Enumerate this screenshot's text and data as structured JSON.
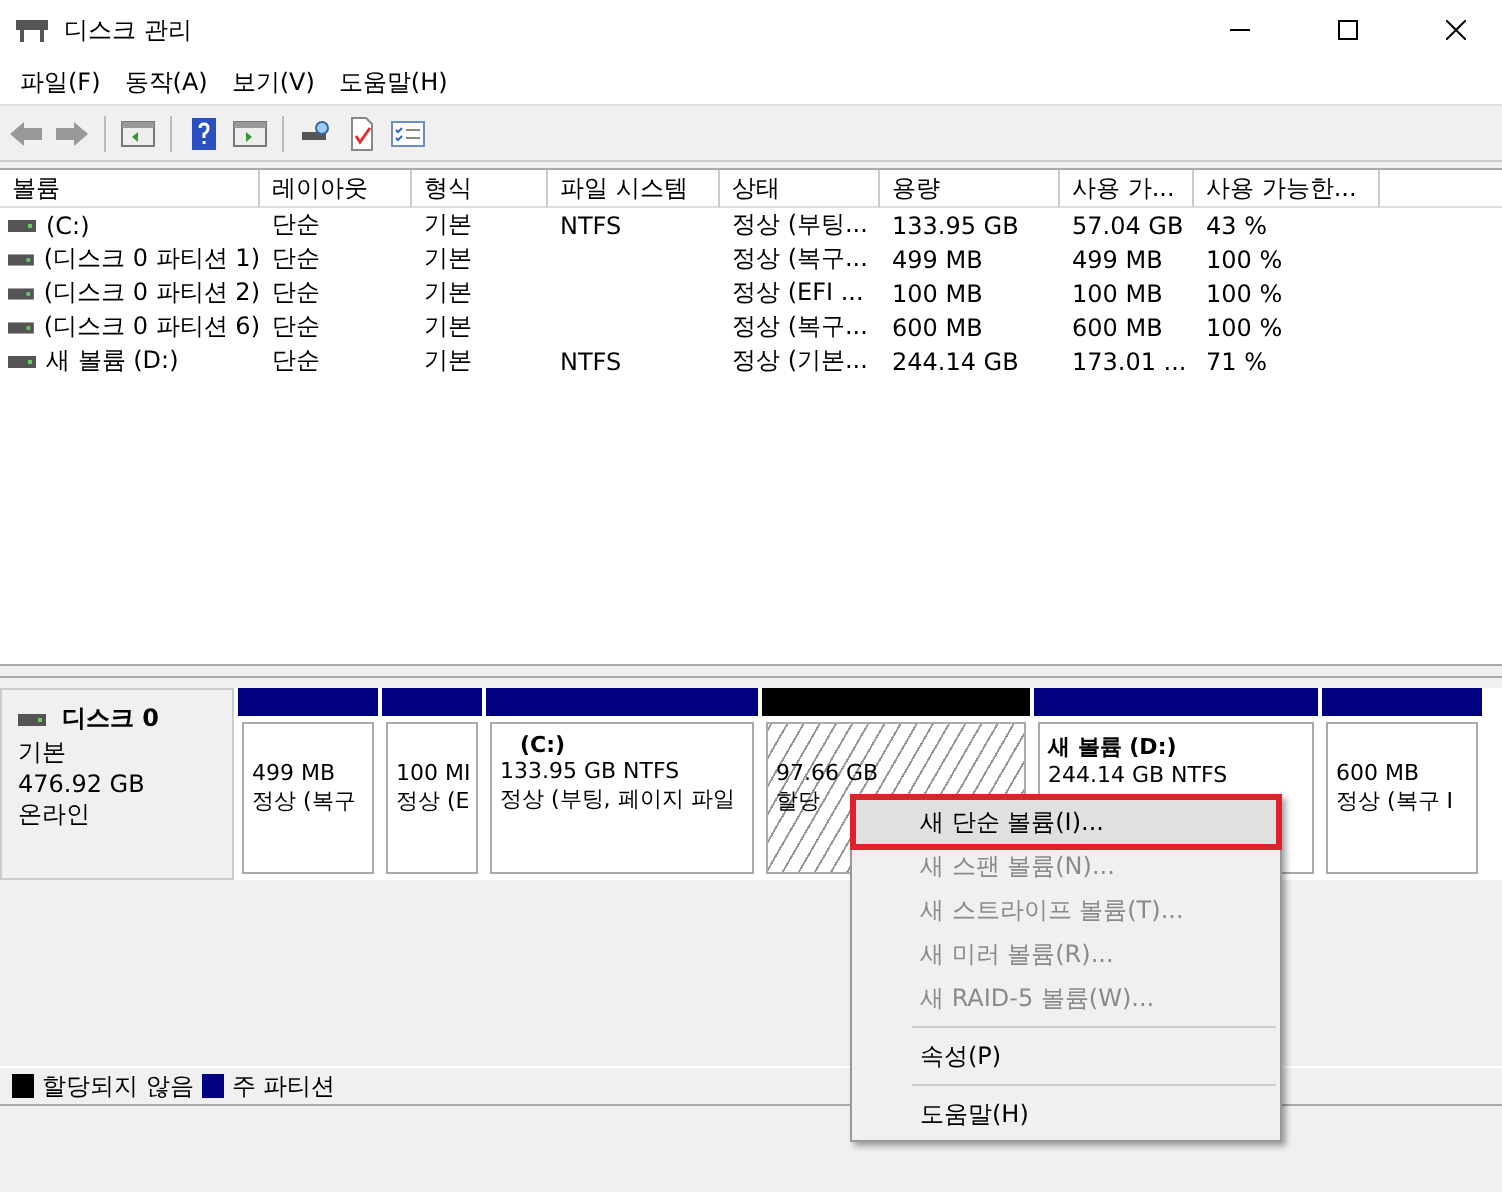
{
  "window": {
    "title": "디스크 관리"
  },
  "menu_bar": [
    "파일(F)",
    "동작(A)",
    "보기(V)",
    "도움말(H)"
  ],
  "volume_table": {
    "columns": [
      "볼륨",
      "레이아웃",
      "형식",
      "파일 시스템",
      "상태",
      "용량",
      "사용 가...",
      "사용 가능한..."
    ],
    "rows": [
      {
        "cells": [
          "(C:)",
          "단순",
          "기본",
          "NTFS",
          "정상 (부팅...",
          "133.95 GB",
          "57.04 GB",
          "43 %"
        ]
      },
      {
        "cells": [
          "(디스크 0 파티션 1)",
          "단순",
          "기본",
          "",
          "정상 (복구...",
          "499 MB",
          "499 MB",
          "100 %"
        ]
      },
      {
        "cells": [
          "(디스크 0 파티션 2)",
          "단순",
          "기본",
          "",
          "정상 (EFI ...",
          "100 MB",
          "100 MB",
          "100 %"
        ]
      },
      {
        "cells": [
          "(디스크 0 파티션 6)",
          "단순",
          "기본",
          "",
          "정상 (복구...",
          "600 MB",
          "600 MB",
          "100 %"
        ]
      },
      {
        "cells": [
          "새 볼륨 (D:)",
          "단순",
          "기본",
          "NTFS",
          "정상 (기본...",
          "244.14 GB",
          "173.01 ...",
          "71 %"
        ]
      }
    ]
  },
  "disks": [
    {
      "name": "디스크 0",
      "type": "기본",
      "size": "476.92 GB",
      "status": "온라인",
      "partitions": [
        {
          "kind": "primary",
          "lines": [
            "499 MB",
            "정상 (복구"
          ]
        },
        {
          "kind": "primary",
          "lines": [
            "100 MI",
            "정상 (E"
          ]
        },
        {
          "kind": "primary",
          "title": "(C:)",
          "lines": [
            "133.95 GB NTFS",
            "정상 (부팅, 페이지 파일"
          ]
        },
        {
          "kind": "unallocated",
          "lines": [
            "97.66 GB",
            "할당"
          ]
        },
        {
          "kind": "primary",
          "title": "새 볼륨  (D:)",
          "lines": [
            "244.14 GB NTFS"
          ]
        },
        {
          "kind": "primary",
          "lines": [
            "600 MB",
            "정상 (복구 I"
          ]
        }
      ]
    }
  ],
  "legend": [
    {
      "label": "할당되지 않음",
      "color": "#000000"
    },
    {
      "label": "주 파티션",
      "color": "#000080"
    }
  ],
  "context_menu": {
    "groups": [
      [
        {
          "label": "새 단순 볼륨(I)...",
          "selected": true,
          "disabled": false
        },
        {
          "label": "새 스팬 볼륨(N)...",
          "selected": false,
          "disabled": true
        },
        {
          "label": "새 스트라이프 볼륨(T)...",
          "selected": false,
          "disabled": true
        },
        {
          "label": "새 미러 볼륨(R)...",
          "selected": false,
          "disabled": true
        },
        {
          "label": "새 RAID-5 볼륨(W)...",
          "selected": false,
          "disabled": true
        }
      ],
      [
        {
          "label": "속성(P)",
          "selected": false,
          "disabled": false
        }
      ],
      [
        {
          "label": "도움말(H)",
          "selected": false,
          "disabled": false
        }
      ]
    ]
  }
}
